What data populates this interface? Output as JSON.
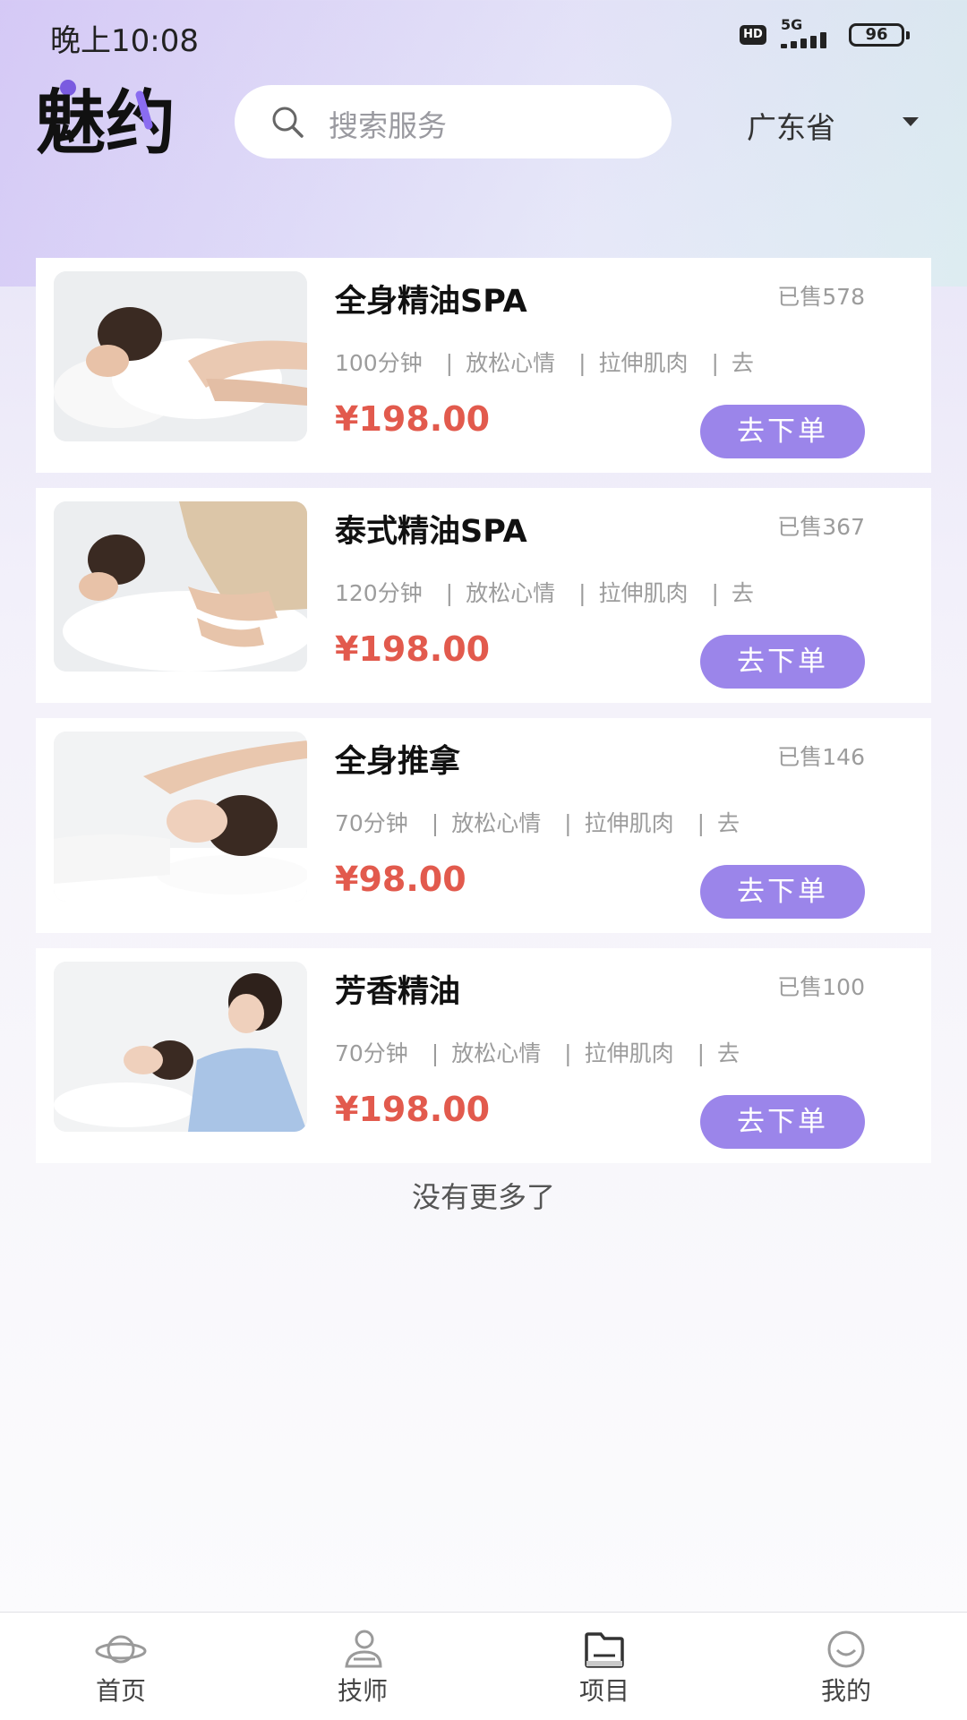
{
  "status_bar": {
    "time": "晚上10:08",
    "hd": "HD",
    "network": "5G",
    "battery": "96"
  },
  "header": {
    "logo_text": "魅约",
    "search_placeholder": "搜索服务",
    "province": "广东省"
  },
  "colors": {
    "accent": "#9b85ea",
    "price": "#e25a4d",
    "muted": "#9c9c9c"
  },
  "services": [
    {
      "title": "全身精油SPA",
      "sold": "已售578",
      "tags": [
        "100分钟",
        "放松心情",
        "拉伸肌肉",
        "去"
      ],
      "price": "¥198.00",
      "button": "去下单"
    },
    {
      "title": "泰式精油SPA",
      "sold": "已售367",
      "tags": [
        "120分钟",
        "放松心情",
        "拉伸肌肉",
        "去"
      ],
      "price": "¥198.00",
      "button": "去下单"
    },
    {
      "title": "全身推拿",
      "sold": "已售146",
      "tags": [
        "70分钟",
        "放松心情",
        "拉伸肌肉",
        "去"
      ],
      "price": "¥98.00",
      "button": "去下单"
    },
    {
      "title": "芳香精油",
      "sold": "已售100",
      "tags": [
        "70分钟",
        "放松心情",
        "拉伸肌肉",
        "去"
      ],
      "price": "¥198.00",
      "button": "去下单"
    }
  ],
  "list_end_text": "没有更多了",
  "tabbar": [
    {
      "label": "首页",
      "icon": "planet-icon"
    },
    {
      "label": "技师",
      "icon": "person-icon"
    },
    {
      "label": "项目",
      "icon": "folder-icon"
    },
    {
      "label": "我的",
      "icon": "smile-face-icon"
    }
  ]
}
